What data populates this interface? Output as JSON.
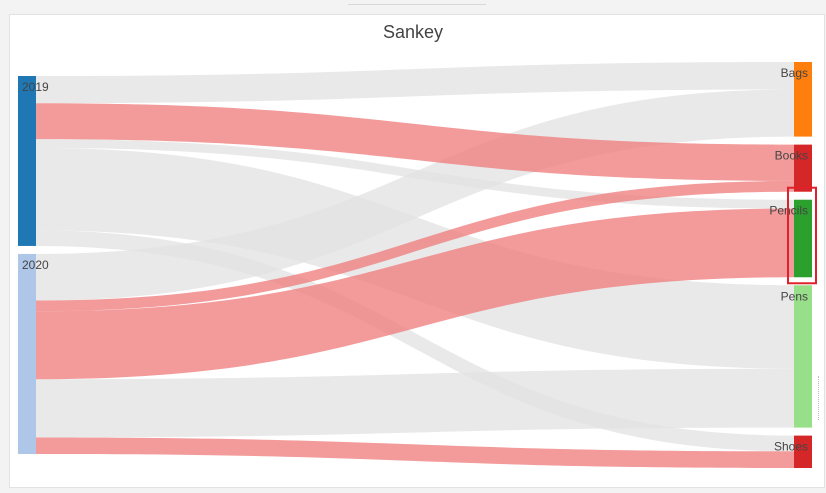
{
  "chart_data": {
    "type": "sankey",
    "title": "Sankey",
    "sources": [
      {
        "name": "2019",
        "color": "#1f77b4"
      },
      {
        "name": "2020",
        "color": "#aec7e8"
      }
    ],
    "targets": [
      {
        "name": "Bags",
        "color": "#ff7f0e"
      },
      {
        "name": "Books",
        "color": "#d62728"
      },
      {
        "name": "Pencils",
        "color": "#2ca02c"
      },
      {
        "name": "Pens",
        "color": "#98df8a"
      },
      {
        "name": "Shoes",
        "color": "#d62728"
      }
    ],
    "links": [
      {
        "source": "2019",
        "target": "Bags",
        "value": 28,
        "highlight": false
      },
      {
        "source": "2019",
        "target": "Books",
        "value": 37,
        "highlight": true
      },
      {
        "source": "2019",
        "target": "Pencils",
        "value": 9,
        "highlight": false
      },
      {
        "source": "2019",
        "target": "Pens",
        "value": 85,
        "highlight": false
      },
      {
        "source": "2019",
        "target": "Shoes",
        "value": 16,
        "highlight": false
      },
      {
        "source": "2020",
        "target": "Bags",
        "value": 48,
        "highlight": false
      },
      {
        "source": "2020",
        "target": "Books",
        "value": 11,
        "highlight": true
      },
      {
        "source": "2020",
        "target": "Pencils",
        "value": 70,
        "highlight": true
      },
      {
        "source": "2020",
        "target": "Pens",
        "value": 60,
        "highlight": false
      },
      {
        "source": "2020",
        "target": "Shoes",
        "value": 17,
        "highlight": true
      }
    ],
    "link_colors": {
      "default": "#e3e3e3",
      "highlight": "#ef7d7d"
    },
    "selected_target": "Pencils",
    "selection_color": "#e0202a"
  }
}
